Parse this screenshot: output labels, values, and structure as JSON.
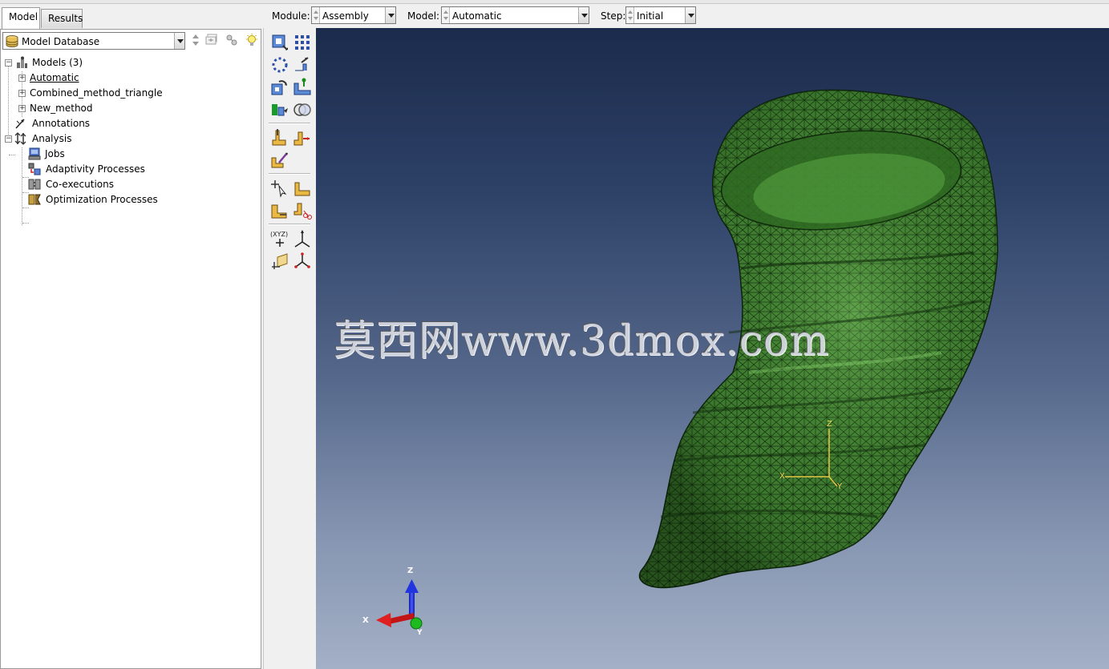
{
  "tabs": {
    "model": "Model",
    "results": "Results"
  },
  "database": {
    "selected": "Model Database"
  },
  "tree": {
    "models": "Models (3)",
    "model_items": [
      "Automatic",
      "Combined_method_triangle",
      "New_method"
    ],
    "annotations": "Annotations",
    "analysis": "Analysis",
    "analysis_items": [
      "Jobs",
      "Adaptivity Processes",
      "Co-executions",
      "Optimization Processes"
    ]
  },
  "toolbar": {
    "module_label": "Module:",
    "module_value": "Assembly",
    "model_label": "Model:",
    "model_value": "Automatic",
    "step_label": "Step:",
    "step_value": "Initial"
  },
  "viewport": {
    "watermark": "莫西网www.3dmox.com",
    "triad": {
      "z": "Z",
      "x": "X",
      "y": "Y"
    },
    "csys": {
      "z": "Z",
      "x": "X",
      "y": "Y"
    }
  },
  "colors": {
    "mesh_fill": "#3f7a30",
    "mesh_line": "#0f2a0b",
    "viewport_top": "#1b2b4c",
    "viewport_bottom": "#a3b0c6",
    "triad_z": "#1d2fd6",
    "triad_x": "#c21616",
    "triad_y": "#1dbb1d"
  },
  "icons": {
    "toolbox": [
      "instance-part-icon",
      "linear-pattern-icon",
      "radial-pattern-icon",
      "translate-instance-icon",
      "rotate-instance-icon",
      "translate-to-icon",
      "convert-constraint-icon",
      "merge-cut-icon",
      "parallel-face-icon",
      "face-to-face-icon",
      "edge-to-edge-icon",
      "select-query-icon",
      "coincident-point-icon",
      "parallel-edge-icon",
      "csys-face-icon",
      "datum-point-icon",
      "datum-axis-icon",
      "datum-plane-icon",
      "datum-csys-icon"
    ]
  }
}
